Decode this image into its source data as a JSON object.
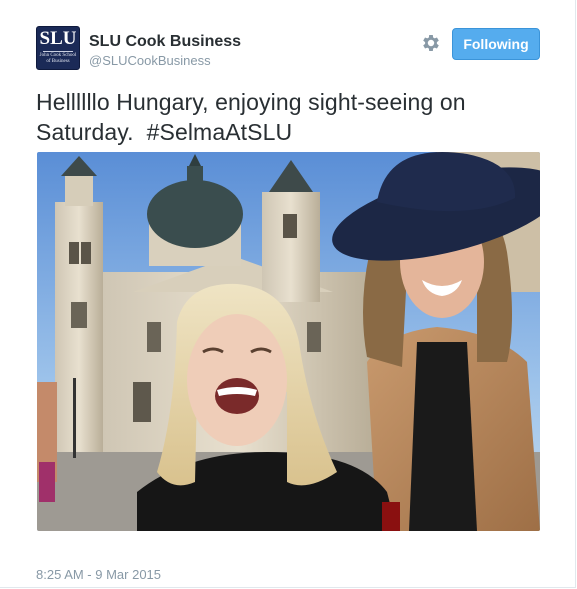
{
  "tweet": {
    "author_name": "SLU Cook Business",
    "author_handle": "@SLUCookBusiness",
    "avatar": {
      "logo_text": "SLU",
      "logo_subtext": "John Cook School of Business"
    },
    "text": "Hellllllo Hungary, enjoying sight-seeing on Saturday.",
    "hashtag": "#SelmaAtSLU",
    "timestamp": "8:25 AM - 9 Mar 2015",
    "follow_button_label": "Following",
    "settings_icon": "gear-icon"
  },
  "colors": {
    "follow_button_bg": "#55acee",
    "text_primary": "#292f33",
    "text_secondary": "#8899a6",
    "avatar_bg": "#1b2a57"
  }
}
